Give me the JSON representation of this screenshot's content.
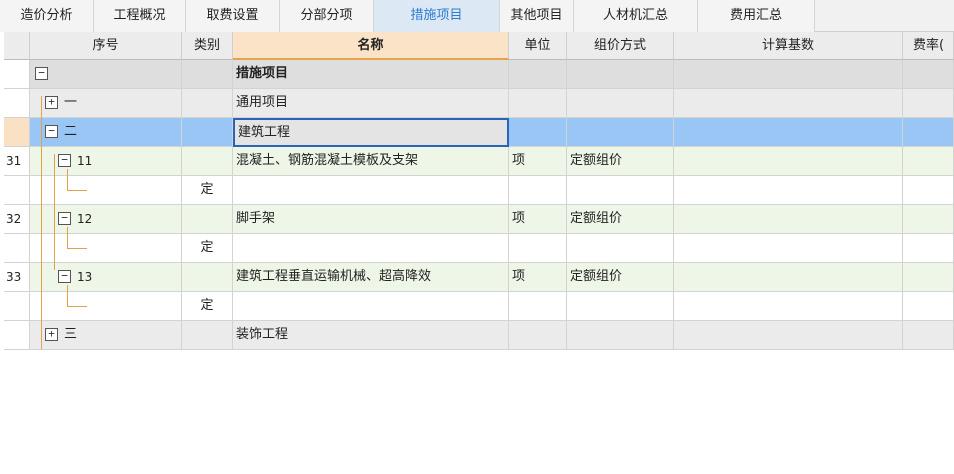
{
  "tabs": [
    {
      "label": "造价分析",
      "active": false
    },
    {
      "label": "工程概况",
      "active": false
    },
    {
      "label": "取费设置",
      "active": false
    },
    {
      "label": "分部分项",
      "active": false
    },
    {
      "label": "措施项目",
      "active": true
    },
    {
      "label": "其他项目",
      "active": false
    },
    {
      "label": "人材机汇总",
      "active": false
    },
    {
      "label": "费用汇总",
      "active": false
    }
  ],
  "columns": {
    "seq": "序号",
    "type": "类别",
    "name": "名称",
    "unit": "单位",
    "pricing": "组价方式",
    "base": "计算基数",
    "rate": "费率("
  },
  "rows": [
    {
      "rownum": "",
      "seq": "",
      "toggle": "−",
      "type": "",
      "name": "措施项目",
      "unit": "",
      "pricing": "",
      "base": "",
      "rate": ""
    },
    {
      "rownum": "",
      "seq": "一",
      "toggle": "+",
      "type": "",
      "name": "通用项目",
      "unit": "",
      "pricing": "",
      "base": "",
      "rate": ""
    },
    {
      "rownum": "",
      "seq": "二",
      "toggle": "−",
      "type": "",
      "name": "建筑工程",
      "unit": "",
      "pricing": "",
      "base": "",
      "rate": ""
    },
    {
      "rownum": "31",
      "seq": "11",
      "toggle": "−",
      "type": "",
      "name": "混凝土、钢筋混凝土模板及支架",
      "unit": "项",
      "pricing": "定额组价",
      "base": "",
      "rate": ""
    },
    {
      "rownum": "",
      "seq": "",
      "toggle": "",
      "type": "定",
      "name": "",
      "unit": "",
      "pricing": "",
      "base": "",
      "rate": ""
    },
    {
      "rownum": "32",
      "seq": "12",
      "toggle": "−",
      "type": "",
      "name": "脚手架",
      "unit": "项",
      "pricing": "定额组价",
      "base": "",
      "rate": ""
    },
    {
      "rownum": "",
      "seq": "",
      "toggle": "",
      "type": "定",
      "name": "",
      "unit": "",
      "pricing": "",
      "base": "",
      "rate": ""
    },
    {
      "rownum": "33",
      "seq": "13",
      "toggle": "−",
      "type": "",
      "name": "建筑工程垂直运输机械、超高降效",
      "unit": "项",
      "pricing": "定额组价",
      "base": "",
      "rate": ""
    },
    {
      "rownum": "",
      "seq": "",
      "toggle": "",
      "type": "定",
      "name": "",
      "unit": "",
      "pricing": "",
      "base": "",
      "rate": ""
    },
    {
      "rownum": "",
      "seq": "三",
      "toggle": "+",
      "type": "",
      "name": "装饰工程",
      "unit": "",
      "pricing": "",
      "base": "",
      "rate": ""
    }
  ],
  "colors": {
    "active_tab_text": "#2d7bd1",
    "selected_row": "#99c6f4",
    "group_row": "#dedede",
    "item_row": "#eef6e8",
    "tree_line": "#e0a24a"
  }
}
